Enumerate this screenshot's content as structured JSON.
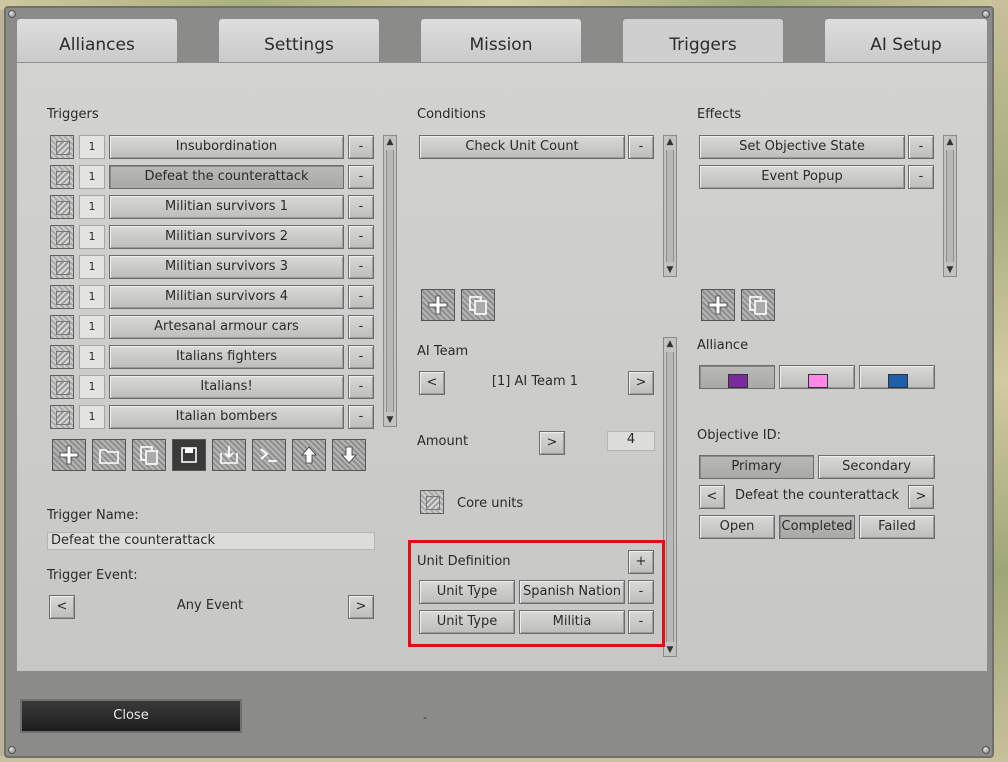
{
  "tabs": [
    "Alliances",
    "Settings",
    "Mission",
    "Triggers",
    "AI Setup"
  ],
  "triggers": {
    "heading": "Triggers",
    "items": [
      {
        "num": "1",
        "name": "Insubordination"
      },
      {
        "num": "1",
        "name": "Defeat the counterattack"
      },
      {
        "num": "1",
        "name": "Militian survivors 1"
      },
      {
        "num": "1",
        "name": "Militian survivors 2"
      },
      {
        "num": "1",
        "name": "Militian survivors 3"
      },
      {
        "num": "1",
        "name": "Militian survivors 4"
      },
      {
        "num": "1",
        "name": "Artesanal armour cars"
      },
      {
        "num": "1",
        "name": "Italians fighters"
      },
      {
        "num": "1",
        "name": "Italians!"
      },
      {
        "num": "1",
        "name": "Italian bombers"
      }
    ],
    "remove_label": "-",
    "toolbar_icons": [
      "add-icon",
      "folder-icon",
      "copy-icon",
      "save-icon",
      "import-icon",
      "console-icon",
      "move-up-icon",
      "move-down-icon"
    ],
    "name_label": "Trigger Name:",
    "name_value": "Defeat the counterattack",
    "event_label": "Trigger Event:",
    "event_value": "Any Event",
    "prev": "<",
    "next": ">"
  },
  "conditions": {
    "heading": "Conditions",
    "items": [
      "Check Unit Count"
    ],
    "ai_team_label": "AI Team",
    "ai_team_value": "[1] AI Team 1",
    "amount_label": "Amount",
    "amount_op": ">",
    "amount_value": "4",
    "core_units_label": "Core units",
    "unit_def_label": "Unit Definition",
    "unit_def_add": "+",
    "unit_defs": [
      {
        "type": "Unit Type",
        "value": "Spanish Nation"
      },
      {
        "type": "Unit Type",
        "value": "Militia"
      }
    ]
  },
  "effects": {
    "heading": "Effects",
    "items": [
      "Set Objective State",
      "Event Popup"
    ],
    "alliance_label": "Alliance",
    "alliance_colors": [
      "#7a2a9a",
      "#ff88e6",
      "#1f5faa"
    ],
    "objective_label": "Objective ID:",
    "objective_types": [
      "Primary",
      "Secondary"
    ],
    "objective_value": "Defeat the counterattack",
    "states": [
      "Open",
      "Completed",
      "Failed"
    ]
  },
  "footer": {
    "close_label": "Close",
    "dash": "-"
  }
}
